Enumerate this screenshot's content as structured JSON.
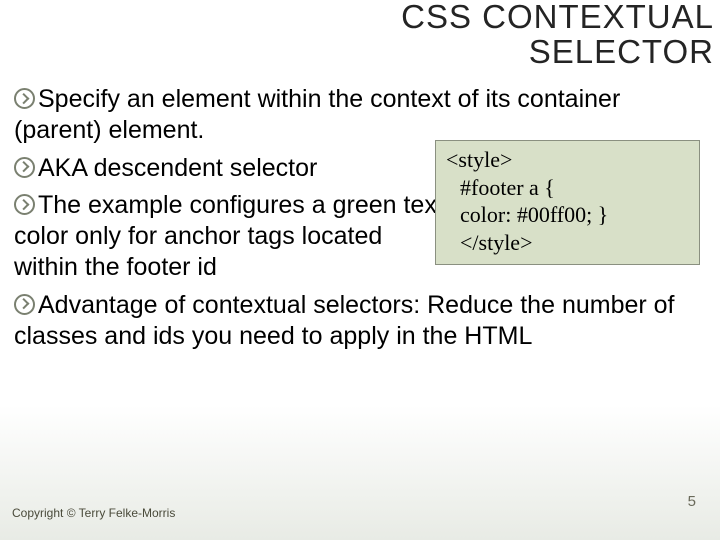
{
  "title_line1": "CSS CONTEXTUAL",
  "title_line2": "SELECTOR",
  "bullets": {
    "b1": "Specify an element within the context of its container (parent) element.",
    "b2": "AKA descendent selector",
    "b3": "The example configures a green text color only for anchor tags located within the footer id",
    "b4": "Advantage of contextual selectors: Reduce the number of classes and ids you need to apply in the HTML"
  },
  "code": {
    "l1": "<style>",
    "l2": "#footer a {",
    "l3": "color: #00ff00; }",
    "l4": "</style>"
  },
  "copyright": "Copyright © Terry Felke-Morris",
  "page": "5"
}
